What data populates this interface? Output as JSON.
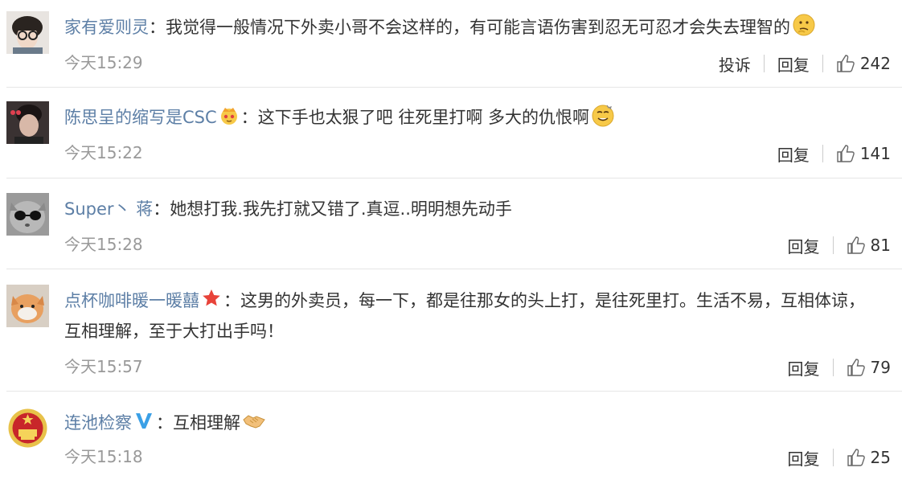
{
  "comments": [
    {
      "username": "家有爱则灵",
      "separator": "：",
      "text": "我觉得一般情况下外卖小哥不会这样的，有可能言语伤害到忍无可忍才会失去理智的",
      "emoji": "thinking-emoji",
      "time": "今天15:29",
      "report_label": "投诉",
      "reply_label": "回复",
      "likes": "242"
    },
    {
      "username": "陈思呈的缩写是CSC",
      "badge": "crown-badge-icon",
      "separator": "：",
      "text": "这下手也太狠了吧 往死里打啊 多大的仇恨啊",
      "emoji": "dizzy-emoji",
      "time": "今天15:22",
      "reply_label": "回复",
      "likes": "141"
    },
    {
      "username": "Super丶 蒋",
      "separator": "：",
      "text": "她想打我.我先打就又错了.真逗..明明想先动手",
      "time": "今天15:28",
      "reply_label": "回复",
      "likes": "81"
    },
    {
      "username": "点杯咖啡暖一暖囍",
      "badge": "star-badge-icon",
      "separator": "：",
      "text": "这男的外卖员，每一下，都是往那女的头上打，是往死里打。生活不易，互相体谅，",
      "text_line2": "互相理解，至于大打出手吗！",
      "time": "今天15:57",
      "reply_label": "回复",
      "likes": "79"
    },
    {
      "username": "连池检察",
      "badge": "verified-v-icon",
      "separator": "：",
      "text": "互相理解",
      "emoji": "handshake-emoji",
      "time": "今天15:18",
      "reply_label": "回复",
      "likes": "25"
    }
  ],
  "colors": {
    "username": "#5d7fa6",
    "text": "#333333",
    "time": "#999999",
    "divider": "#e6e6e6",
    "verified": "#3ba0e6",
    "star": "#e8433a"
  }
}
